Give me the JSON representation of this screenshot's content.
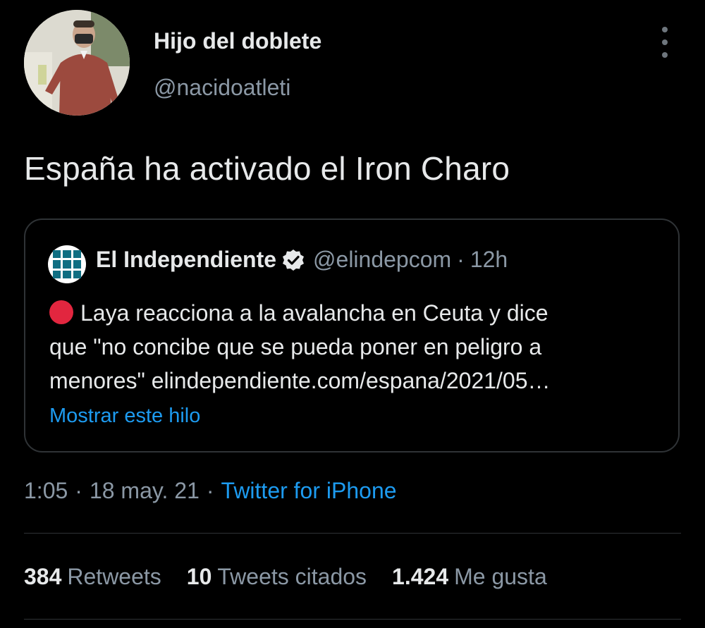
{
  "author": {
    "display_name": "Hijo del doblete",
    "handle": "@nacidoatleti",
    "avatar_icon": "profile-photo-avatar"
  },
  "tweet": {
    "text": "España ha activado el Iron Charo"
  },
  "quoted": {
    "name": "El Independiente",
    "verified_icon": "verified-badge-icon",
    "handle": "@elindepcom",
    "separator": "·",
    "time": "12h",
    "line1": "Laya reacciona a la avalancha en Ceuta y dice",
    "line2": "que \"no concibe que se pueda poner en peligro a",
    "line3": "menores\" elindependiente.com/espana/2021/05…",
    "show_thread": "Mostrar este hilo"
  },
  "meta": {
    "time": "1:05",
    "sep1": "·",
    "date": "18 may. 21",
    "sep2": "·",
    "source": "Twitter for iPhone"
  },
  "stats": {
    "retweets_count": "384",
    "retweets_label": "Retweets",
    "quotes_count": "10",
    "quotes_label": "Tweets citados",
    "likes_count": "1.424",
    "likes_label": "Me gusta"
  },
  "colors": {
    "background": "#000000",
    "text": "#e7e9ea",
    "secondary": "#8b98a5",
    "link": "#1d9bf0",
    "border": "#2f3336",
    "red_circle": "#e2263f"
  }
}
